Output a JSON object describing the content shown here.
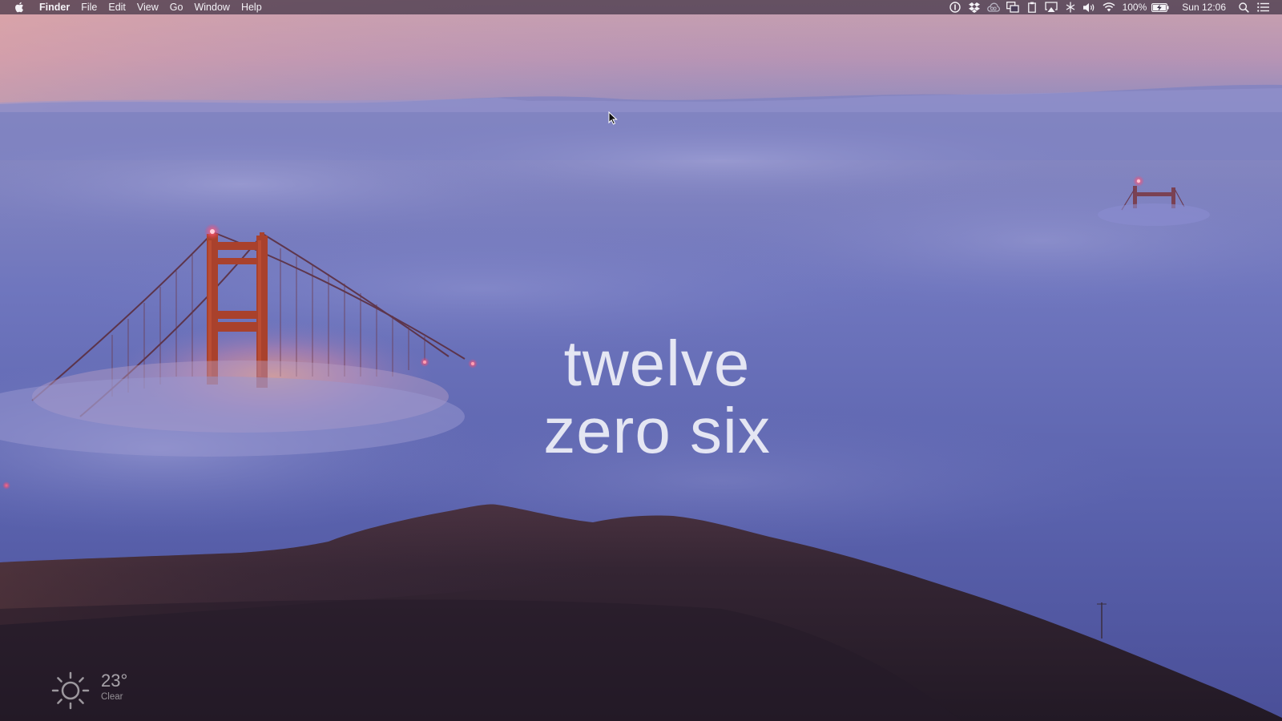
{
  "menubar": {
    "apple_icon": "apple-logo-icon",
    "app_name": "Finder",
    "menus": [
      "File",
      "Edit",
      "View",
      "Go",
      "Window",
      "Help"
    ],
    "status_icons": [
      "1password-icon",
      "dropbox-icon",
      "creative-cloud-icon",
      "screen-share-icon",
      "clipboard-icon",
      "airplay-icon",
      "network-icon",
      "volume-icon",
      "wifi-icon"
    ],
    "battery_percent": "100%",
    "battery_icon": "battery-charging-icon",
    "clock": "Sun 12:06",
    "spotlight_icon": "spotlight-search-icon",
    "notification_icon": "notification-center-icon"
  },
  "clock_widget": {
    "line1": "twelve",
    "line2": "zero six"
  },
  "weather_widget": {
    "icon": "sun-icon",
    "temperature": "23°",
    "condition": "Clear"
  },
  "colors": {
    "sky_top": "#c79aa8",
    "fog": "#6f74bb",
    "hill": "#2e2233",
    "bridge": "#b5462b",
    "beacon": "#ff4d6b"
  }
}
